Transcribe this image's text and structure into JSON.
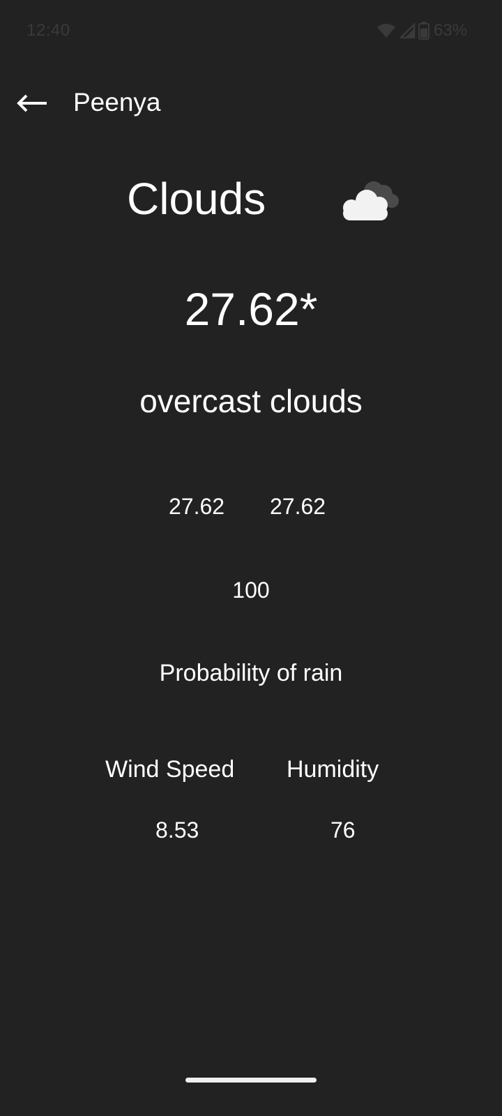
{
  "status_bar": {
    "time": "12:40",
    "battery_percent": "63%",
    "icons": [
      "wifi-icon",
      "cellular-signal-icon",
      "battery-icon"
    ],
    "color": "#3a3a3a"
  },
  "app_bar": {
    "back_icon": "back-arrow-icon",
    "title": "Peenya"
  },
  "weather": {
    "main": "Clouds",
    "icon": "cloud-icon",
    "temperature": "27.62*",
    "description": "overcast clouds",
    "temp_min": "27.62",
    "temp_max": "27.62",
    "clouds": "100",
    "rain_label": "Probability of rain",
    "wind_speed_label": "Wind Speed",
    "humidity_label": "Humidity",
    "wind_speed": "8.53",
    "humidity": "76"
  },
  "colors": {
    "background": "#222222",
    "text": "#ffffff"
  }
}
